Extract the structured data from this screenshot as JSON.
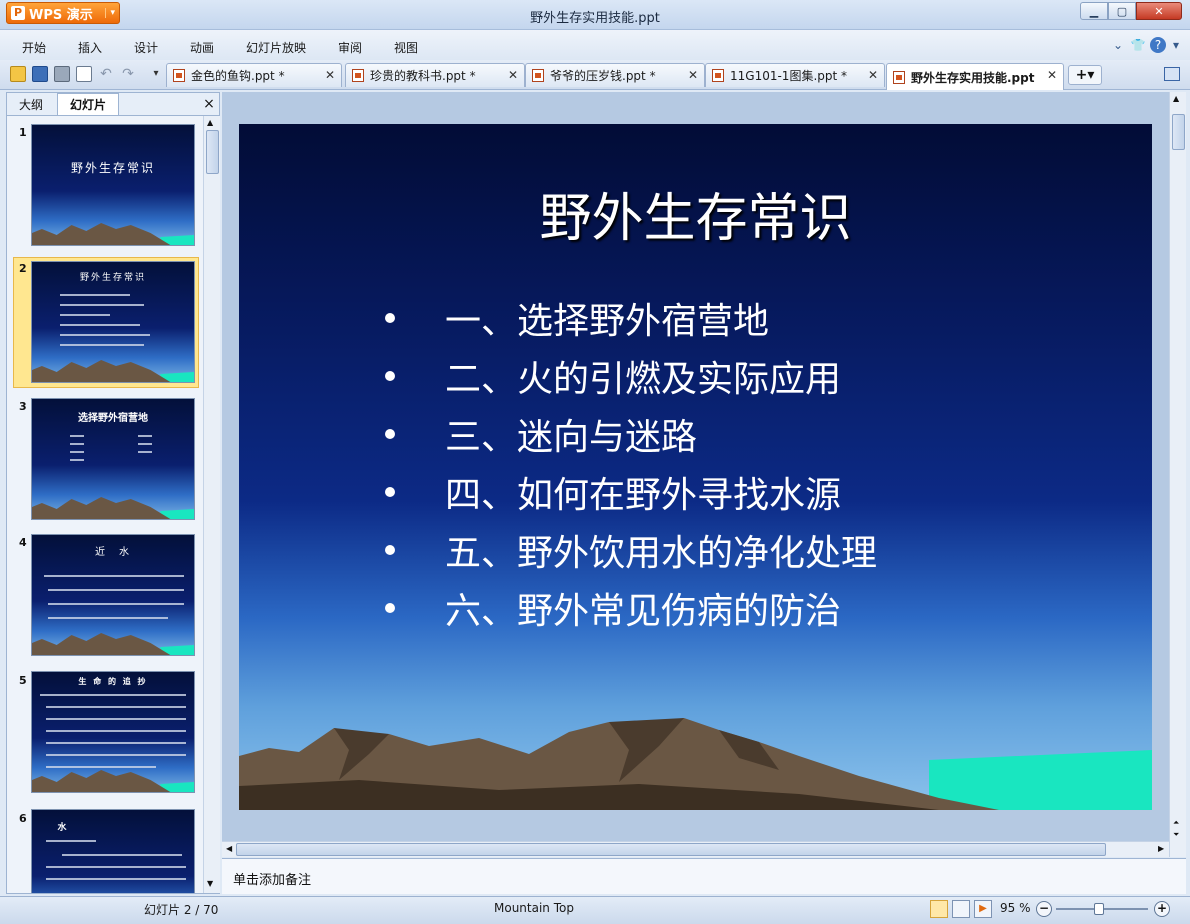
{
  "app": {
    "name": "WPS 演示",
    "window_title": "野外生存实用技能.ppt"
  },
  "menu": [
    "开始",
    "插入",
    "设计",
    "动画",
    "幻灯片放映",
    "审阅",
    "视图"
  ],
  "doc_tabs": [
    {
      "label": "金色的鱼钩.ppt *",
      "active": false
    },
    {
      "label": "珍贵的教科书.ppt *",
      "active": false
    },
    {
      "label": "爷爷的压岁钱.ppt *",
      "active": false
    },
    {
      "label": "11G101-1图集.ppt *",
      "active": false
    },
    {
      "label": "野外生存实用技能.ppt",
      "active": true
    }
  ],
  "panel": {
    "tab_outline": "大纲",
    "tab_slides": "幻灯片",
    "close": "×"
  },
  "thumbnails": [
    {
      "num": "1",
      "title": "野外生存常识"
    },
    {
      "num": "2",
      "title": "野外生存常识",
      "selected": true
    },
    {
      "num": "3",
      "title": "选择野外宿营地"
    },
    {
      "num": "4",
      "title": "近　水"
    },
    {
      "num": "5",
      "title": "生 命 的 追 抄"
    },
    {
      "num": "6",
      "title": "水"
    }
  ],
  "slide": {
    "title": "野外生存常识",
    "bullets": [
      "一、选择野外宿营地",
      "二、火的引燃及实际应用",
      "三、迷向与迷路",
      "四、如何在野外寻找水源",
      "五、野外饮用水的净化处理",
      "六、野外常见伤病的防治"
    ]
  },
  "notes_placeholder": "单击添加备注",
  "status": {
    "slide_counter": "幻灯片 2 / 70",
    "theme": "Mountain Top",
    "zoom": "95 %"
  },
  "colors": {
    "accent_orange": "#ee6a08",
    "slide_top": "#020c36",
    "sea": "#19e6c0",
    "mountain": "#6a5744"
  }
}
